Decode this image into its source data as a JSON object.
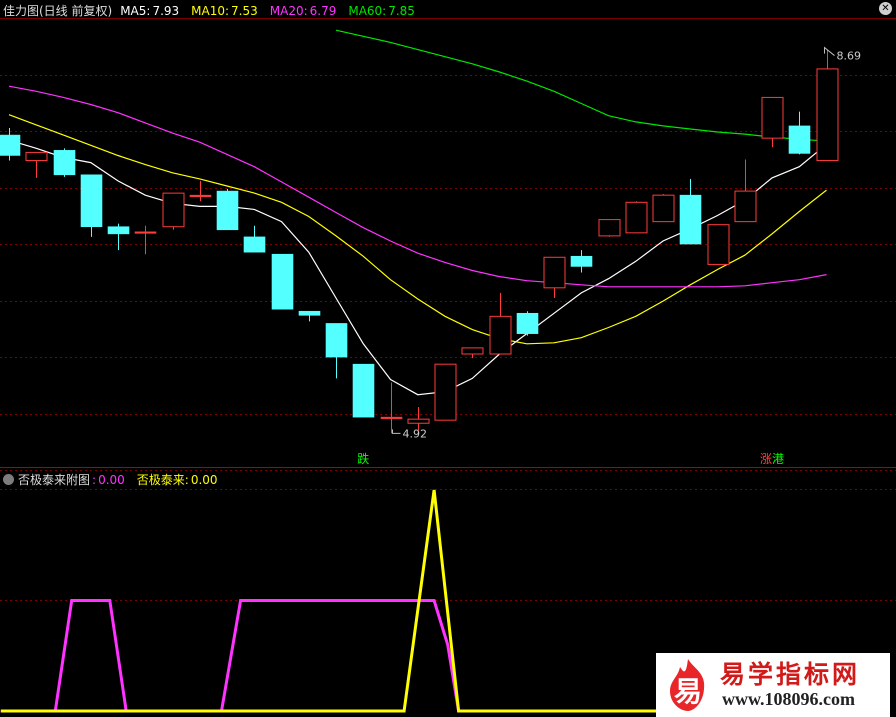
{
  "header": {
    "title": "佳力图(日线 前复权)",
    "ma": [
      {
        "label": "MA5:",
        "value": "7.93",
        "color": "#ffffff"
      },
      {
        "label": "MA10:",
        "value": "7.53",
        "color": "#ffff00"
      },
      {
        "label": "MA20:",
        "value": "6.79",
        "color": "#ff33ff"
      },
      {
        "label": "MA60:",
        "value": "7.85",
        "color": "#00e600"
      }
    ]
  },
  "sub_header": {
    "title": "否极泰来附图",
    "items": [
      {
        "label": ":",
        "value": "0.00",
        "color": "#ff33ff"
      },
      {
        "label": "否极泰来:",
        "value": "0.00",
        "color": "#ffff00"
      }
    ]
  },
  "chart_data": [
    {
      "type": "candlestick",
      "ylim": [
        4.6,
        9.0
      ],
      "annotations": [
        {
          "text": "8.69",
          "at_value": 8.69
        },
        {
          "text": "4.92",
          "at_value": 4.92
        },
        {
          "text": "跌",
          "color": "#00ff00"
        },
        {
          "text": "涨",
          "color": "#ff4444"
        },
        {
          "text": "港",
          "color": "#00ff00"
        }
      ],
      "candles": [
        {
          "o": 7.85,
          "h": 7.92,
          "c": 7.65,
          "l": 7.6
        },
        {
          "o": 7.6,
          "h": 7.68,
          "c": 7.68,
          "l": 7.43
        },
        {
          "o": 7.7,
          "h": 7.72,
          "c": 7.46,
          "l": 7.44
        },
        {
          "o": 7.46,
          "h": 7.46,
          "c": 6.95,
          "l": 6.85
        },
        {
          "o": 6.95,
          "h": 6.98,
          "c": 6.88,
          "l": 6.72
        },
        {
          "o": 6.9,
          "h": 6.96,
          "c": 6.9,
          "l": 6.68
        },
        {
          "o": 6.95,
          "h": 7.28,
          "c": 7.28,
          "l": 6.92
        },
        {
          "o": 7.26,
          "h": 7.4,
          "c": 7.26,
          "l": 7.2
        },
        {
          "o": 7.3,
          "h": 7.32,
          "c": 6.92,
          "l": 6.92
        },
        {
          "o": 6.85,
          "h": 6.96,
          "c": 6.7,
          "l": 6.7
        },
        {
          "o": 6.68,
          "h": 6.68,
          "c": 6.14,
          "l": 6.14
        },
        {
          "o": 6.12,
          "h": 6.12,
          "c": 6.08,
          "l": 6.02
        },
        {
          "o": 6.0,
          "h": 6.0,
          "c": 5.67,
          "l": 5.46
        },
        {
          "o": 5.6,
          "h": 5.6,
          "c": 5.08,
          "l": 5.08
        },
        {
          "o": 5.08,
          "h": 5.42,
          "c": 5.08,
          "l": 4.92
        },
        {
          "o": 5.02,
          "h": 5.18,
          "c": 5.06,
          "l": 4.95
        },
        {
          "o": 5.05,
          "h": 5.6,
          "c": 5.6,
          "l": 5.05
        },
        {
          "o": 5.7,
          "h": 5.76,
          "c": 5.76,
          "l": 5.66
        },
        {
          "o": 5.7,
          "h": 6.3,
          "c": 6.07,
          "l": 5.7
        },
        {
          "o": 6.1,
          "h": 6.12,
          "c": 5.9,
          "l": 5.88
        },
        {
          "o": 6.35,
          "h": 6.65,
          "c": 6.65,
          "l": 6.25
        },
        {
          "o": 6.66,
          "h": 6.72,
          "c": 6.56,
          "l": 6.5
        },
        {
          "o": 6.86,
          "h": 7.02,
          "c": 7.02,
          "l": 6.85
        },
        {
          "o": 6.89,
          "h": 7.2,
          "c": 7.19,
          "l": 6.89
        },
        {
          "o": 7.0,
          "h": 7.27,
          "c": 7.26,
          "l": 7.0
        },
        {
          "o": 7.26,
          "h": 7.42,
          "c": 6.78,
          "l": 6.78
        },
        {
          "o": 6.58,
          "h": 6.97,
          "c": 6.97,
          "l": 6.58
        },
        {
          "o": 7.0,
          "h": 7.61,
          "c": 7.3,
          "l": 7.0
        },
        {
          "o": 7.82,
          "h": 8.22,
          "c": 8.22,
          "l": 7.73
        },
        {
          "o": 7.94,
          "h": 8.08,
          "c": 7.67,
          "l": 7.66
        },
        {
          "o": 7.6,
          "h": 8.69,
          "c": 8.5,
          "l": 7.6
        }
      ],
      "series": [
        {
          "name": "MA5",
          "color": "#ffffff",
          "values": [
            7.8,
            7.72,
            7.63,
            7.58,
            7.4,
            7.26,
            7.18,
            7.15,
            7.15,
            7.12,
            7.0,
            6.7,
            6.25,
            5.8,
            5.45,
            5.3,
            5.33,
            5.46,
            5.7,
            5.9,
            6.1,
            6.3,
            6.44,
            6.61,
            6.81,
            6.93,
            7.06,
            7.21,
            7.43,
            7.54,
            7.76
          ]
        },
        {
          "name": "MA10",
          "color": "#ffff00",
          "values": [
            8.05,
            7.95,
            7.85,
            7.75,
            7.65,
            7.56,
            7.48,
            7.42,
            7.35,
            7.28,
            7.19,
            7.05,
            6.86,
            6.66,
            6.43,
            6.24,
            6.07,
            5.94,
            5.85,
            5.8,
            5.81,
            5.86,
            5.96,
            6.07,
            6.22,
            6.38,
            6.53,
            6.67,
            6.88,
            7.1,
            7.31
          ]
        },
        {
          "name": "MA20",
          "color": "#ff33ff",
          "values": [
            8.33,
            8.28,
            8.22,
            8.15,
            8.07,
            7.97,
            7.87,
            7.78,
            7.66,
            7.54,
            7.39,
            7.24,
            7.09,
            6.94,
            6.81,
            6.69,
            6.6,
            6.52,
            6.46,
            6.42,
            6.4,
            6.38,
            6.36,
            6.36,
            6.36,
            6.36,
            6.36,
            6.37,
            6.4,
            6.43,
            6.48
          ]
        },
        {
          "name": "MA60",
          "color": "#00e600",
          "values": [
            null,
            null,
            null,
            null,
            null,
            null,
            null,
            null,
            null,
            null,
            null,
            null,
            8.88,
            8.82,
            8.76,
            8.69,
            8.62,
            8.55,
            8.47,
            8.38,
            8.28,
            8.16,
            8.04,
            7.98,
            7.94,
            7.91,
            7.88,
            7.86,
            7.83,
            7.81,
            7.79
          ]
        }
      ]
    },
    {
      "type": "line",
      "ylim": [
        0,
        1
      ],
      "series": [
        {
          "name": "",
          "color": "#ff33ff",
          "x": [
            -0.3,
            1.7,
            2.3,
            3.7,
            4.3,
            7.8,
            8.5,
            14.3,
            15.6,
            16.1,
            16.5,
            31.2
          ],
          "values": [
            0,
            0,
            0.5,
            0.5,
            0,
            0,
            0.5,
            0.5,
            0.5,
            0.3,
            0,
            0
          ]
        },
        {
          "name": "否极泰来",
          "color": "#ffff00",
          "x": [
            -0.3,
            14.5,
            15.6,
            16.5,
            31.2
          ],
          "values": [
            0,
            0,
            1,
            0,
            0
          ]
        }
      ]
    }
  ],
  "watermark": {
    "icon": "flame-icon",
    "glyph": "易",
    "name": "易学指标网",
    "url": "www.108096.com"
  }
}
